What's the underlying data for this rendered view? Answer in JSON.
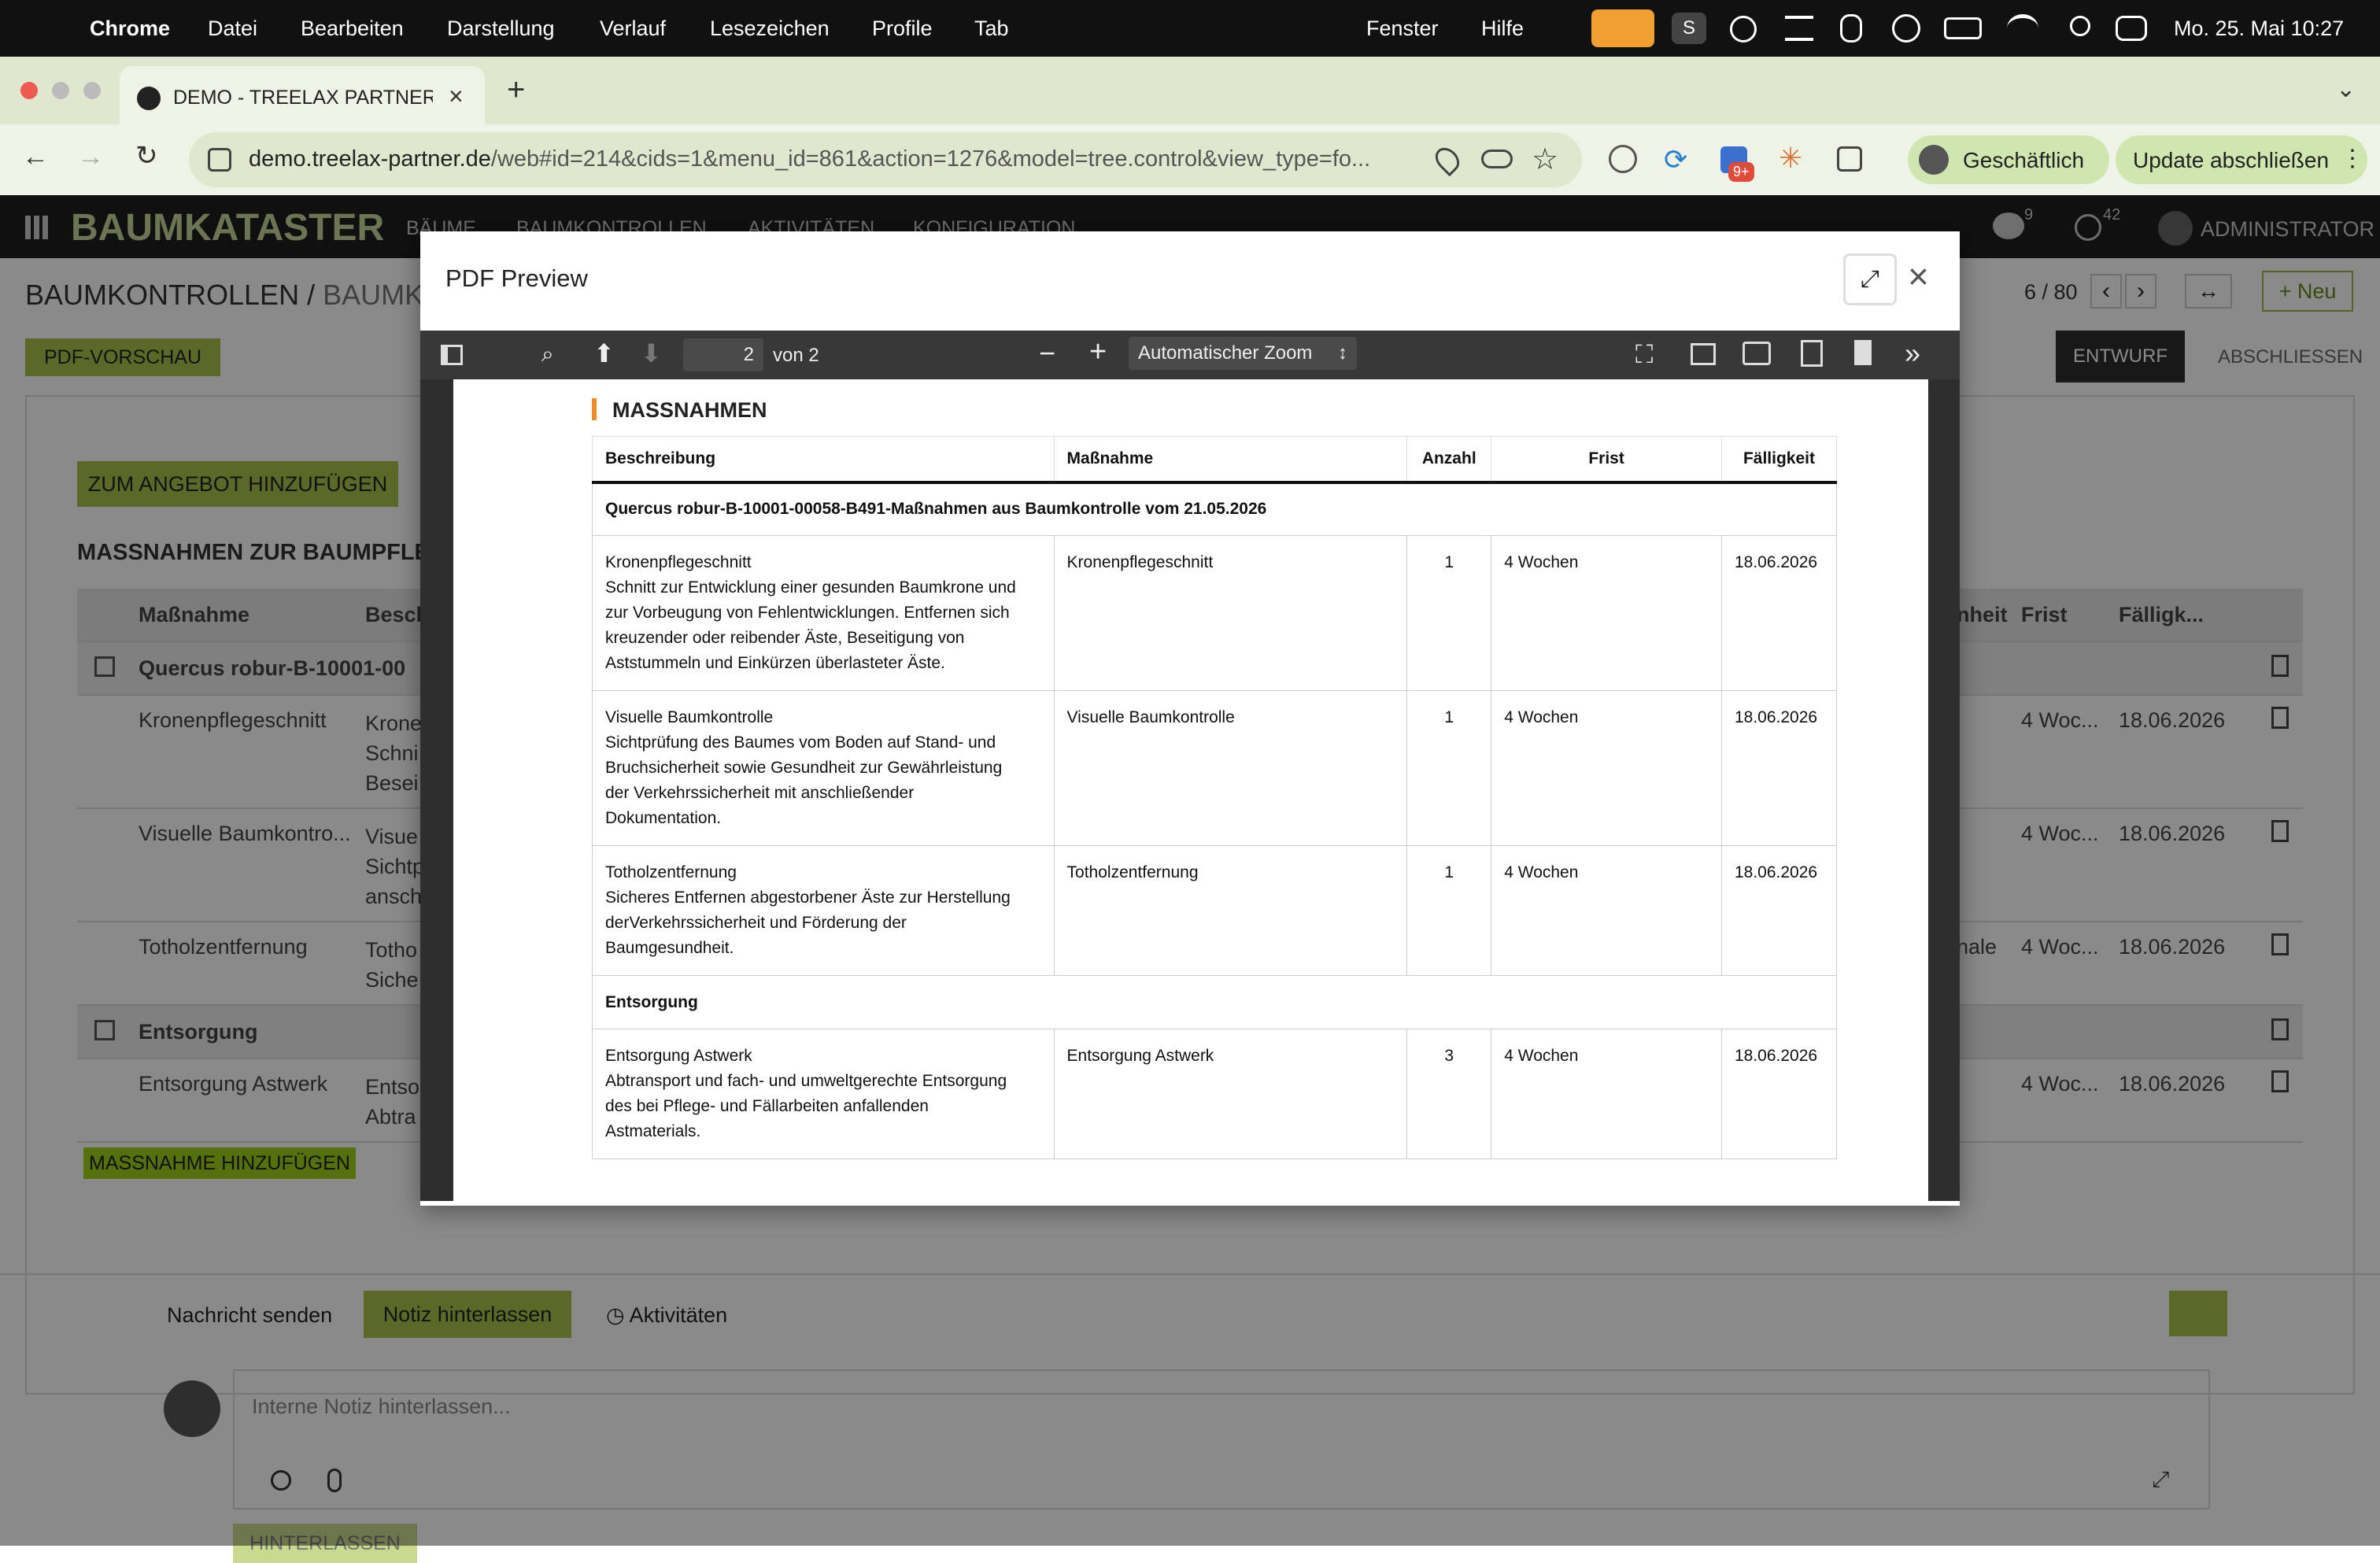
{
  "mac": {
    "app": "Chrome",
    "menus": [
      "Datei",
      "Bearbeiten",
      "Darstellung",
      "Verlauf",
      "Lesezeichen",
      "Profile",
      "Tab",
      "Fenster",
      "Hilfe"
    ],
    "datetime": "Mo. 25. Mai  10:27"
  },
  "browser": {
    "tab_title": "DEMO - TREELAX PARTNER -",
    "url_host": "demo.treelax-partner.de",
    "url_path": "/web#id=214&cids=1&menu_id=861&action=1276&model=tree.control&view_type=fo...",
    "ext_badge": "9+",
    "profile_label": "Geschäftlich",
    "update_label": "Update abschließen"
  },
  "app": {
    "brand": "BAUMKATASTER",
    "nav": [
      "BÄUME",
      "BAUMKONTROLLEN",
      "AKTIVITÄTEN",
      "KONFIGURATION"
    ],
    "chat_count": "9",
    "activity_count": "42",
    "user": "ADMINISTRATOR",
    "breadcrumb_root": "BAUMKONTROLLEN",
    "breadcrumb_sep": "/",
    "breadcrumb_current": "BAUMKO",
    "pager": "6 / 80",
    "new_label": "Neu",
    "pdf_button": "PDF-VORSCHAU",
    "status": [
      "ENTWURF",
      "ABSCHLIESSEN"
    ],
    "add_offer": "ZUM ANGEBOT HINZUFÜGEN",
    "section_title": "MASSNAHMEN ZUR BAUMPFLE",
    "table_headers": {
      "left": [
        "Maßnahme",
        "Besch"
      ],
      "right": [
        "nheit",
        "Frist",
        "Fälligk..."
      ]
    },
    "rows": [
      {
        "type": "group",
        "name": "Quercus robur-B-10001-00"
      },
      {
        "type": "line",
        "name": "Kronenpflegeschnitt",
        "desc": [
          "Krone",
          "Schni",
          "Besei"
        ],
        "unit": "",
        "frist": "4 Woc...",
        "due": "18.06.2026"
      },
      {
        "type": "line",
        "name": "Visuelle Baumkontro...",
        "desc": [
          "Visue",
          "Sichtp",
          "ansch"
        ],
        "unit": "",
        "frist": "4 Woc...",
        "due": "18.06.2026"
      },
      {
        "type": "line",
        "name": "Totholzentfernung",
        "desc": [
          "Totho",
          "Siche"
        ],
        "unit": "nale",
        "frist": "4 Woc...",
        "due": "18.06.2026"
      },
      {
        "type": "group",
        "name": "Entsorgung"
      },
      {
        "type": "line",
        "name": "Entsorgung Astwerk",
        "desc": [
          "Entso",
          "Abtra"
        ],
        "unit": "",
        "frist": "4 Woc...",
        "due": "18.06.2026"
      }
    ],
    "add_measure": "MASSNAHME HINZUFÜGEN",
    "chatter": {
      "send": "Nachricht senden",
      "note": "Notiz hinterlassen",
      "activities": "Aktivitäten",
      "placeholder": "Interne Notiz hinterlassen...",
      "submit": "HINTERLASSEN"
    }
  },
  "modal": {
    "title": "PDF Preview",
    "pdf": {
      "page": "2",
      "of": "von 2",
      "zoom": "Automatischer Zoom"
    },
    "section": "MASSNAHMEN",
    "headers": [
      "Beschreibung",
      "Maßnahme",
      "Anzahl",
      "Frist",
      "Fälligkeit"
    ],
    "rows": [
      {
        "group": "Quercus robur-B-10001-00058-B491-Maßnahmen aus Baumkontrolle vom 21.05.2026"
      },
      {
        "desc": [
          "Kronenpflegeschnitt",
          "Schnitt zur Entwicklung einer gesunden Baumkrone und",
          "zur Vorbeugung von Fehlentwicklungen. Entfernen sich",
          "kreuzender oder reibender Äste, Beseitigung von",
          "Aststummeln und Einkürzen überlasteter Äste."
        ],
        "measure": "Kronenpflegeschnitt",
        "qty": "1",
        "frist": "4 Wochen",
        "due": "18.06.2026"
      },
      {
        "desc": [
          "Visuelle Baumkontrolle",
          "Sichtprüfung des Baumes vom Boden auf Stand- und",
          "Bruchsicherheit sowie Gesundheit zur Gewährleistung",
          "der Verkehrssicherheit mit anschließender",
          "Dokumentation."
        ],
        "measure": "Visuelle Baumkontrolle",
        "qty": "1",
        "frist": "4 Wochen",
        "due": "18.06.2026"
      },
      {
        "desc": [
          "Totholzentfernung",
          "Sicheres Entfernen abgestorbener Äste zur Herstellung",
          "derVerkehrssicherheit und Förderung der",
          "Baumgesundheit."
        ],
        "measure": "Totholzentfernung",
        "qty": "1",
        "frist": "4 Wochen",
        "due": "18.06.2026"
      },
      {
        "group": "Entsorgung"
      },
      {
        "desc": [
          "Entsorgung Astwerk",
          "Abtransport und fach- und umweltgerechte Entsorgung",
          "des bei Pflege- und Fällarbeiten anfallenden",
          "Astmaterials."
        ],
        "measure": "Entsorgung Astwerk",
        "qty": "3",
        "frist": "4 Wochen",
        "due": "18.06.2026"
      }
    ]
  }
}
